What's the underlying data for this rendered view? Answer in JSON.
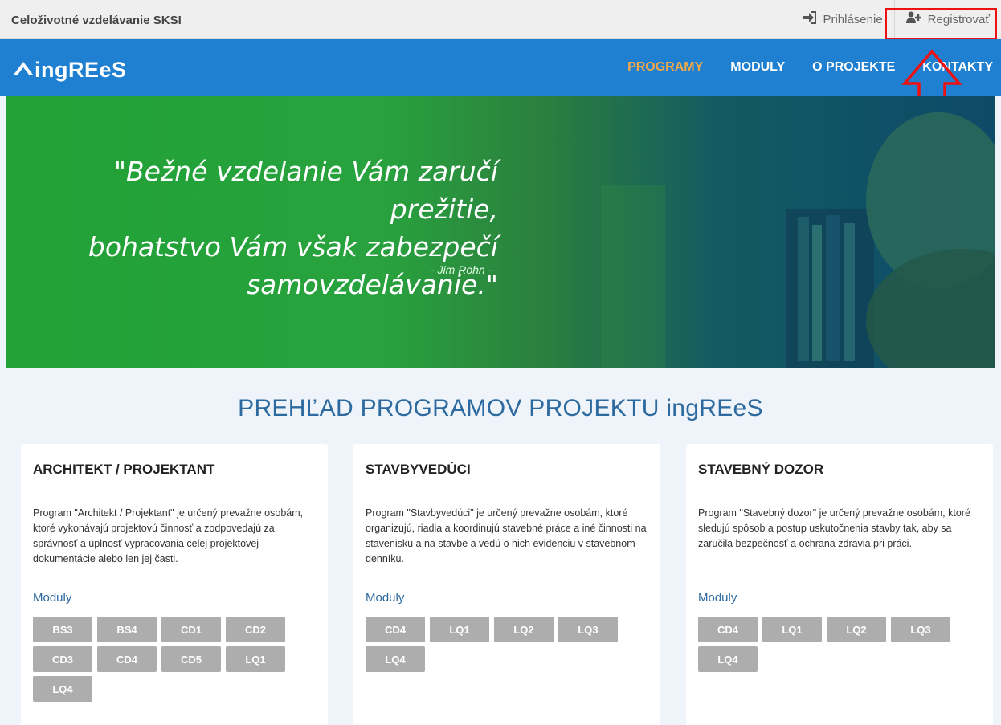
{
  "topbar": {
    "site_name": "Celoživotné vzdelávanie SKSI",
    "login_label": "Prihlásenie",
    "register_label": "Registrovať"
  },
  "nav": {
    "logo_text": "ingREeS",
    "items": [
      {
        "label": "PROGRAMY",
        "active": true
      },
      {
        "label": "MODULY",
        "active": false
      },
      {
        "label": "O PROJEKTE",
        "active": false
      },
      {
        "label": "KONTAKTY",
        "active": false
      }
    ]
  },
  "hero": {
    "quote_line1": "\"Bežné vzdelanie Vám zaručí prežitie,",
    "quote_line2": "bohatstvo Vám však zabezpečí",
    "quote_line3": "samovzdelávanie.\"",
    "author": "- Jim Rohn -"
  },
  "section": {
    "title": "PREHĽAD PROGRAMOV PROJEKTU ingREeS"
  },
  "cards": [
    {
      "title": "ARCHITEKT / PROJEKTANT",
      "description": "Program \"Architekt / Projektant\" je určený prevažne osobám, ktoré vykonávajú projektovú činnosť a zodpovedajú za správnosť a úplnosť vypracovania celej projektovej dokumentácie alebo len jej časti.",
      "modules_label": "Moduly",
      "modules": [
        "BS3",
        "BS4",
        "CD1",
        "CD2",
        "CD3",
        "CD4",
        "CD5",
        "LQ1",
        "LQ4"
      ]
    },
    {
      "title": "STAVBYVEDÚCI",
      "description": "Program \"Stavbyvedúci\" je určený prevažne osobám, ktoré organizujú, riadia a koordinujú stavebné práce a iné činnosti na stavenisku a na stavbe a vedú o nich evidenciu v stavebnom denníku.",
      "modules_label": "Moduly",
      "modules": [
        "CD4",
        "LQ1",
        "LQ2",
        "LQ3",
        "LQ4"
      ]
    },
    {
      "title": "STAVEBNÝ DOZOR",
      "description": "Program \"Stavebný dozor\" je určený prevažne osobám, ktoré sledujú spôsob a postup uskutočnenia stavby tak, aby sa zaručila bezpečnosť a ochrana zdravia pri práci.",
      "modules_label": "Moduly",
      "modules": [
        "CD4",
        "LQ1",
        "LQ2",
        "LQ3",
        "LQ4"
      ]
    }
  ],
  "icons": {
    "login": "sign-in-icon",
    "register": "user-plus-icon",
    "logo": "ingrees-logo-icon"
  },
  "colors": {
    "nav_bg": "#1f7fd0",
    "nav_active": "#f0a94a",
    "hero_green": "#29a23e",
    "title_blue": "#2d6a9f",
    "chip_gray": "#adadad",
    "annotation_red": "#ee1111"
  }
}
